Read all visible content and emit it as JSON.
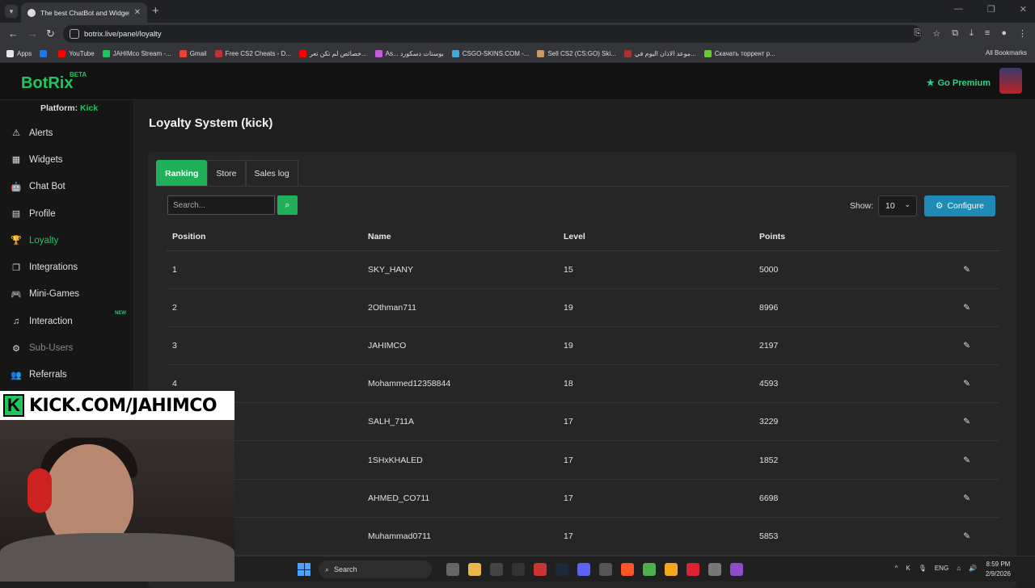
{
  "browser": {
    "tab_title": "The best ChatBot and Widgets f",
    "url": "botrix.live/panel/loyalty",
    "bookmarks": [
      {
        "label": "Apps",
        "color": "#e8e8e8"
      },
      {
        "label": "",
        "color": "#1877f2"
      },
      {
        "label": "YouTube",
        "color": "#ff0000"
      },
      {
        "label": "JAHIMco Stream -...",
        "color": "#21c55d"
      },
      {
        "label": "Gmail",
        "color": "#ea4335"
      },
      {
        "label": "Free CS2 Cheats - D...",
        "color": "#b33"
      },
      {
        "label": "خصائص لم تكن تعر...",
        "color": "#ff0000"
      },
      {
        "label": "As... بوستات دسكورد",
        "color": "#c65be0"
      },
      {
        "label": "CSGO-SKINS.COM -...",
        "color": "#4ad"
      },
      {
        "label": "Sell CS2 (CS:GO) Ski...",
        "color": "#c96"
      },
      {
        "label": "موعد الاذان اليوم في...",
        "color": "#a33"
      },
      {
        "label": "Скачать торрент р...",
        "color": "#6c3"
      }
    ],
    "all_bookmarks": "All Bookmarks"
  },
  "header": {
    "logo": "BotRix",
    "beta": "BETA",
    "premium": "Go Premium"
  },
  "sidebar": {
    "platform_label": "Platform:",
    "platform_value": "Kick",
    "items": [
      {
        "label": "Alerts",
        "icon": "⚠"
      },
      {
        "label": "Widgets",
        "icon": "▦"
      },
      {
        "label": "Chat Bot",
        "icon": "🤖"
      },
      {
        "label": "Profile",
        "icon": "▤"
      },
      {
        "label": "Loyalty",
        "icon": "🏆"
      },
      {
        "label": "Integrations",
        "icon": "❐"
      },
      {
        "label": "Mini-Games",
        "icon": "🎮"
      },
      {
        "label": "Interaction",
        "icon": "♫",
        "badge": "NEW"
      },
      {
        "label": "Sub-Users",
        "icon": "⚙"
      },
      {
        "label": "Referrals",
        "icon": "👥"
      }
    ]
  },
  "main": {
    "title": "Loyalty System (kick)",
    "tabs": [
      "Ranking",
      "Store",
      "Sales log"
    ],
    "search_placeholder": "Search...",
    "show_label": "Show:",
    "show_value": "10",
    "configure": "Configure",
    "columns": [
      "Position",
      "Name",
      "Level",
      "Points"
    ],
    "rows": [
      {
        "position": "1",
        "name": "SKY_HANY",
        "level": "15",
        "points": "5000"
      },
      {
        "position": "2",
        "name": "2Othman711",
        "level": "19",
        "points": "8996"
      },
      {
        "position": "3",
        "name": "JAHIMCO",
        "level": "19",
        "points": "2197"
      },
      {
        "position": "4",
        "name": "Mohammed12358844",
        "level": "18",
        "points": "4593"
      },
      {
        "position": "5",
        "name": "SALH_711A",
        "level": "17",
        "points": "3229"
      },
      {
        "position": "",
        "name": "1SHxKHALED",
        "level": "17",
        "points": "1852"
      },
      {
        "position": "",
        "name": "AHMED_CO711",
        "level": "17",
        "points": "6698"
      },
      {
        "position": "",
        "name": "Muhammad0711",
        "level": "17",
        "points": "5853"
      }
    ]
  },
  "overlay": {
    "badge": "K",
    "text": "KICK.COM/JAHIMCO"
  },
  "taskbar": {
    "search": "Search",
    "lang": "ENG",
    "time": "8:59 PM",
    "date": "2/9/2026"
  }
}
